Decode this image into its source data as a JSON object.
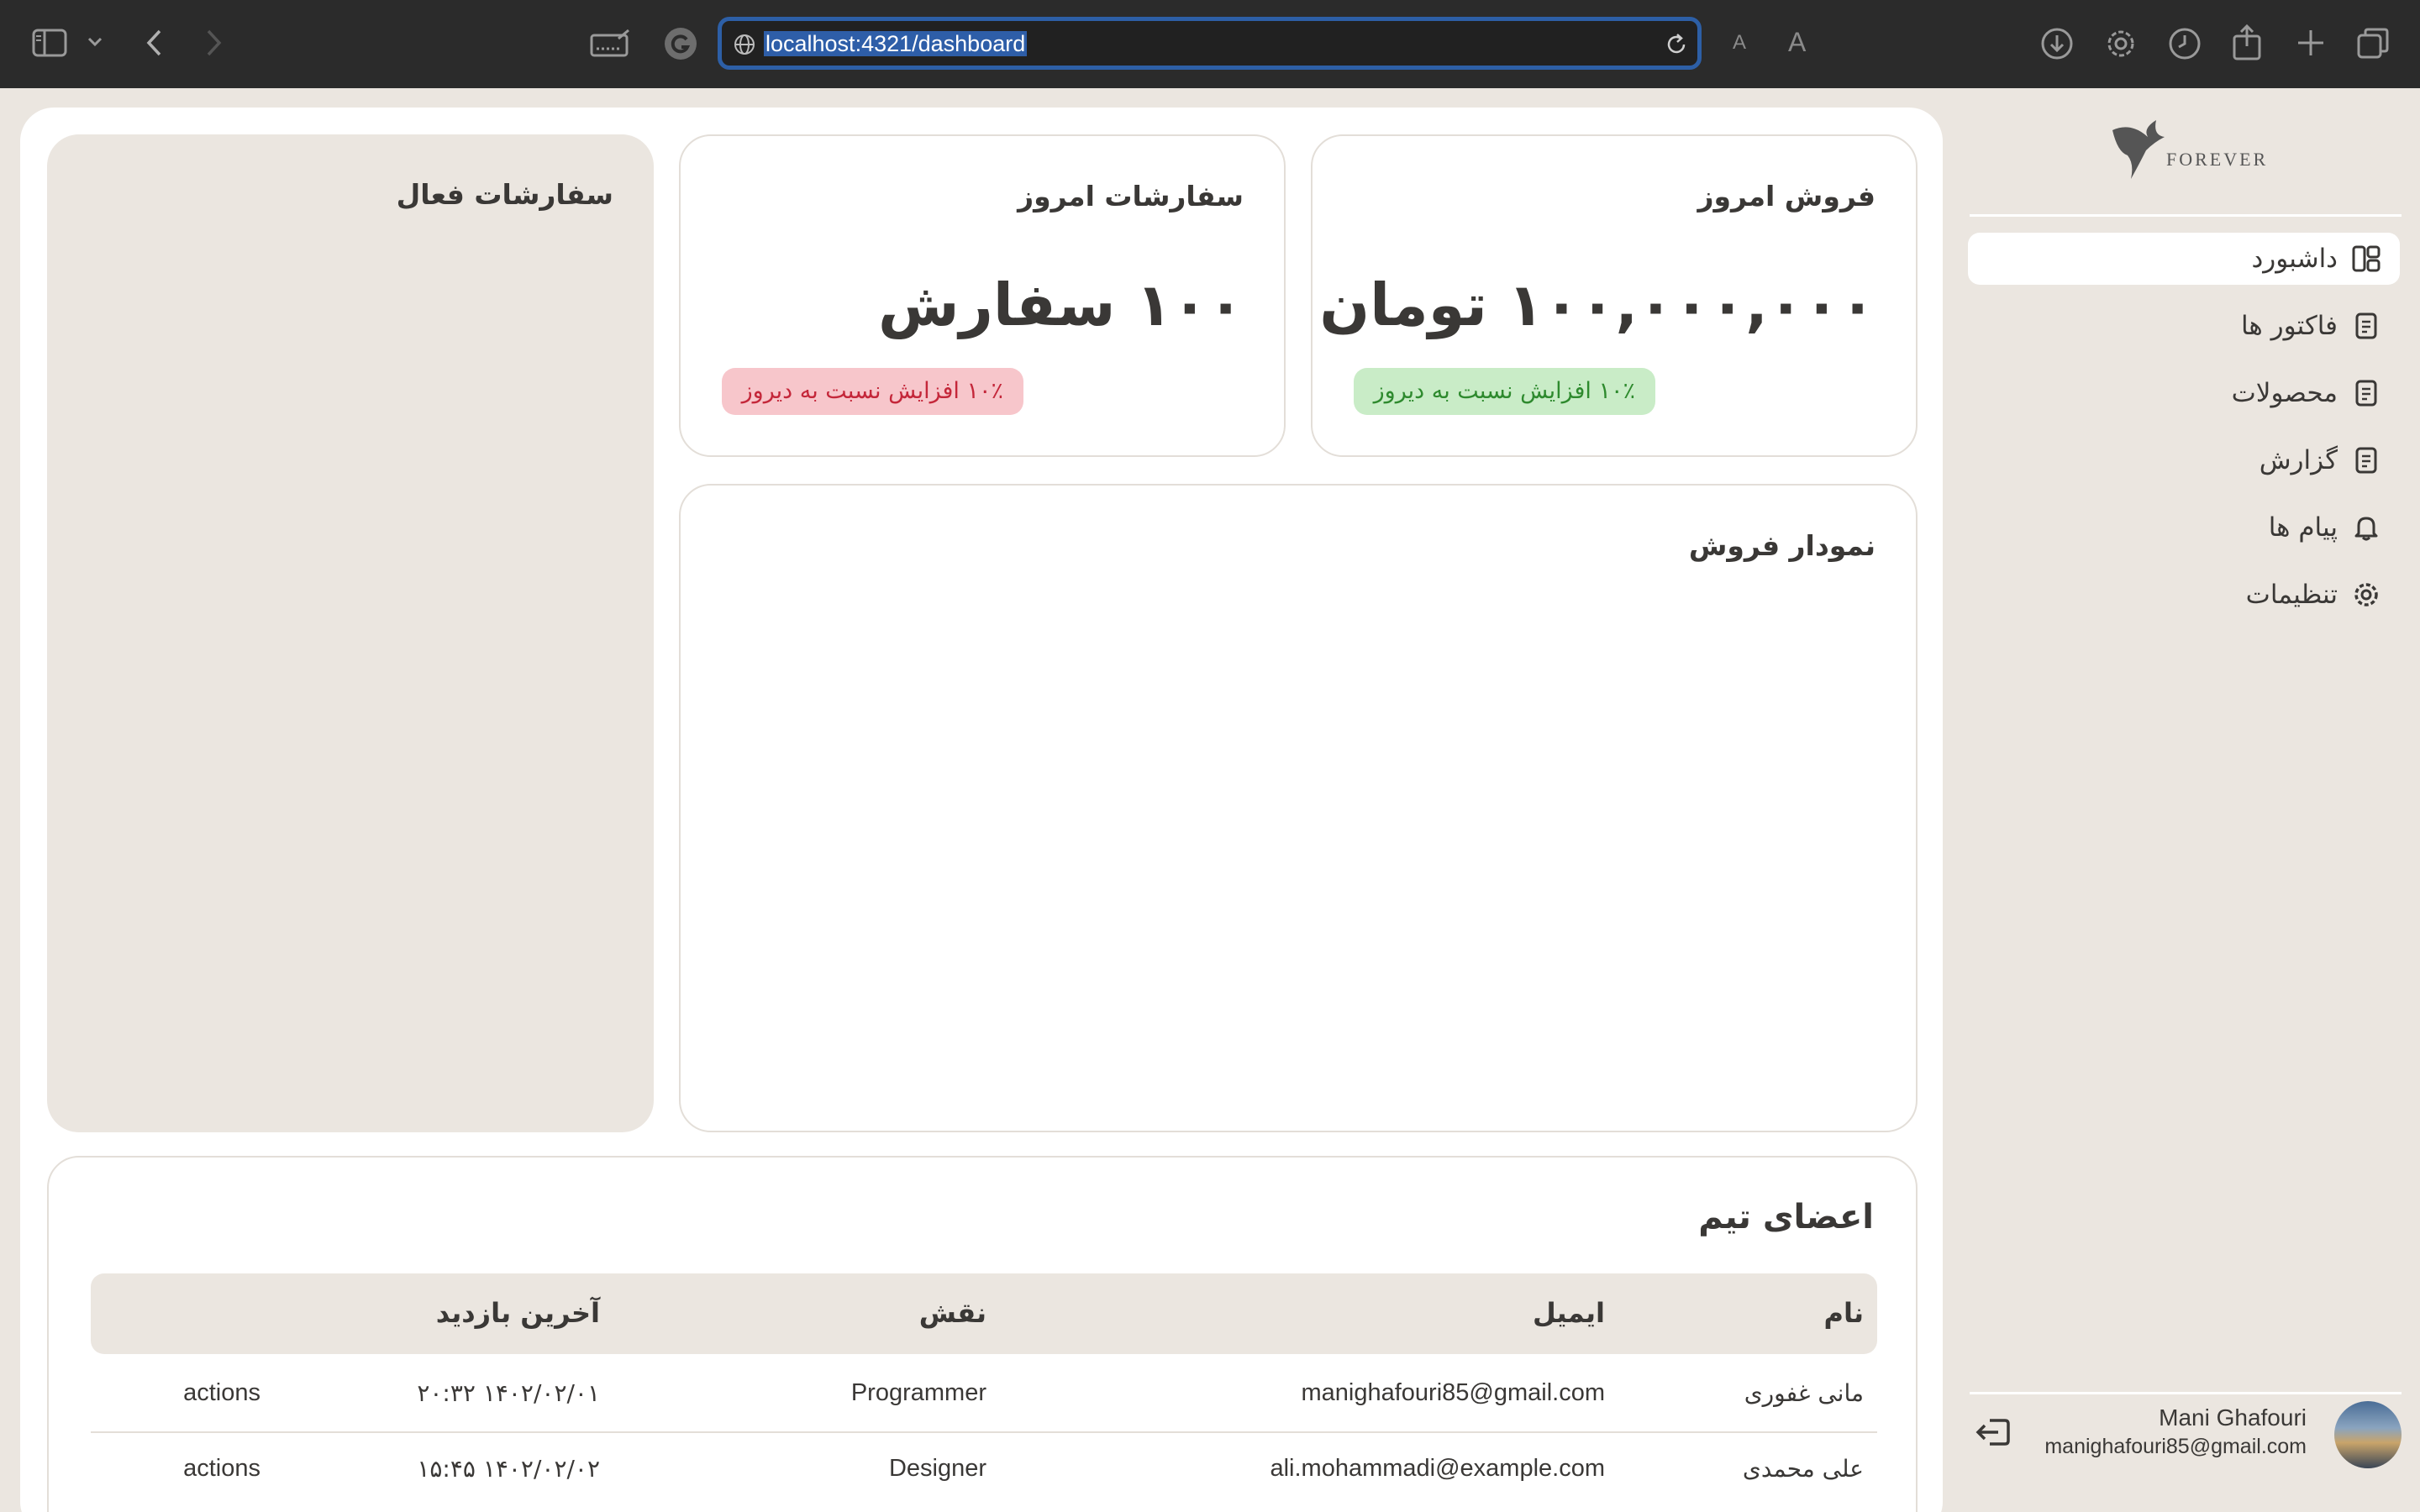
{
  "browser": {
    "url": "localhost:4321/dashboard",
    "font_small": "A",
    "font_large": "A",
    "icons": [
      "sidebar-toggle-icon",
      "chevron-down-icon",
      "back-icon",
      "forward-icon",
      "reader-icon",
      "grammarly-icon",
      "globe-icon",
      "reload-icon",
      "download-icon",
      "gear-icon",
      "history-icon",
      "share-icon",
      "plus-icon",
      "tabs-icon"
    ]
  },
  "sidebar": {
    "logo_text": "FOREVER",
    "items": [
      {
        "label": "داشبورد",
        "icon": "dashboard-icon",
        "active": true
      },
      {
        "label": "فاکتور ها",
        "icon": "document-icon",
        "active": false
      },
      {
        "label": "محصولات",
        "icon": "document-icon",
        "active": false
      },
      {
        "label": "گزارش",
        "icon": "document-icon",
        "active": false
      },
      {
        "label": "پیام ها",
        "icon": "bell-icon",
        "active": false
      },
      {
        "label": "تنظیمات",
        "icon": "gear-icon",
        "active": false
      }
    ],
    "user": {
      "name": "Mani Ghafouri",
      "email": "manighafouri85@gmail.com"
    }
  },
  "cards": {
    "sales": {
      "title": "فروش امروز",
      "value": "۱۰۰,۰۰۰,۰۰۰ تومان",
      "badge": "۱۰٪ افزایش نسبت به دیروز",
      "badge_color": "#c9ecc7"
    },
    "orders": {
      "title": "سفارشات امروز",
      "value": "۱۰۰ سفارش",
      "badge": "۱۰٪ افزایش نسبت به دیروز",
      "badge_color": "#f7c6cb"
    },
    "active_orders": {
      "title": "سفارشات فعال"
    },
    "chart": {
      "title": "نمودار فروش"
    }
  },
  "team": {
    "title": "اعضای تیم",
    "headers": {
      "name": "نام",
      "email": "ایمیل",
      "role": "نقش",
      "last_visit": "آخرین بازدید"
    },
    "rows": [
      {
        "name": "مانی غفوری",
        "email": "manighafouri85@gmail.com",
        "role": "Programmer",
        "last_visit": "۱۴۰۲/۰۲/۰۱ ۲۰:۳۲",
        "actions": "actions"
      },
      {
        "name": "علی محمدی",
        "email": "ali.mohammadi@example.com",
        "role": "Designer",
        "last_visit": "۱۴۰۲/۰۲/۰۲ ۱۵:۴۵",
        "actions": "actions"
      }
    ]
  },
  "colors": {
    "page_bg": "#ebe6e0",
    "toolbar_bg": "#2b2b2b",
    "url_highlight": "#2e5ea8",
    "badge_green_text": "#2e8a2e",
    "badge_red_text": "#c4273a"
  }
}
